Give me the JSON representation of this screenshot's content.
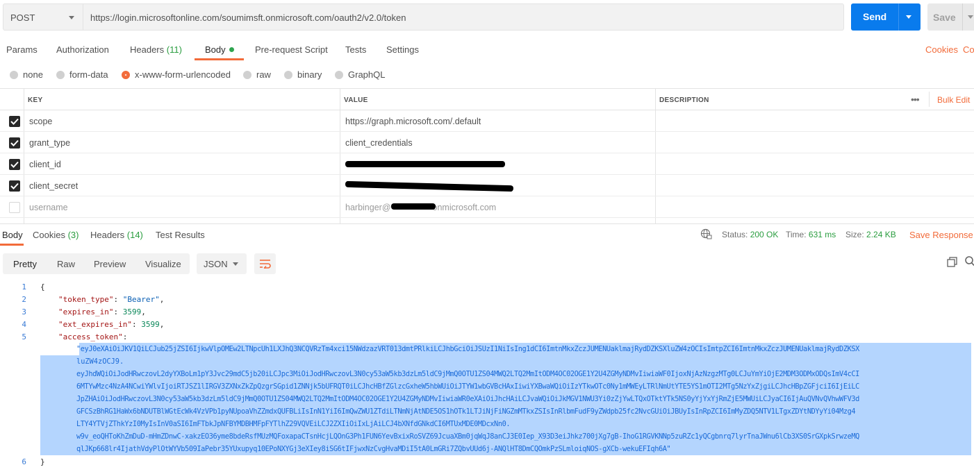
{
  "request": {
    "method": "POST",
    "url": "https://login.microsoftonline.com/soumimsft.onmicrosoft.com/oauth2/v2.0/token",
    "send_label": "Send",
    "save_label": "Save"
  },
  "req_tabs": {
    "params": "Params",
    "authorization": "Authorization",
    "headers": "Headers",
    "headers_count": "(11)",
    "body": "Body",
    "prerequest": "Pre-request Script",
    "tests": "Tests",
    "settings": "Settings",
    "cookies": "Cookies",
    "code": "Co"
  },
  "body_types": {
    "none": "none",
    "form_data": "form-data",
    "urlencoded": "x-www-form-urlencoded",
    "raw": "raw",
    "binary": "binary",
    "graphql": "GraphQL",
    "selected": "x-www-form-urlencoded"
  },
  "params_table": {
    "headers": {
      "key": "KEY",
      "value": "VALUE",
      "description": "DESCRIPTION",
      "bulk_edit": "Bulk Edit",
      "more": "•••"
    },
    "rows": [
      {
        "key": "scope",
        "value": "https://graph.microsoft.com/.default",
        "checked": true
      },
      {
        "key": "grant_type",
        "value": "client_credentials",
        "checked": true
      },
      {
        "key": "client_id",
        "value": "",
        "checked": true
      },
      {
        "key": "client_secret",
        "value": "",
        "checked": true
      },
      {
        "key": "username",
        "value_prefix": "harbinger@",
        "value_suffix": "onmicrosoft.com",
        "checked": false
      }
    ]
  },
  "response": {
    "tabs": {
      "body": "Body",
      "cookies": "Cookies",
      "cookies_count": "(3)",
      "headers": "Headers",
      "headers_count": "(14)",
      "test_results": "Test Results"
    },
    "status_label": "Status:",
    "status_value": "200 OK",
    "time_label": "Time:",
    "time_value": "631 ms",
    "size_label": "Size:",
    "size_value": "2.24 KB",
    "save_response": "Save Response",
    "views": {
      "pretty": "Pretty",
      "raw": "Raw",
      "preview": "Preview",
      "visualize": "Visualize"
    },
    "format": "JSON",
    "line_numbers": [
      "1",
      "2",
      "3",
      "4",
      "5",
      "6"
    ],
    "json": {
      "open_brace": "{",
      "close_brace": "}",
      "token_type_key": "\"token_type\"",
      "token_type_value": "\"Bearer\"",
      "expires_in_key": "\"expires_in\"",
      "expires_in_value": "3599",
      "ext_expires_in_key": "\"ext_expires_in\"",
      "ext_expires_in_value": "3599",
      "access_token_key": "\"access_token\"",
      "access_token_lines": [
        "\"eyJ0eXAiOiJKV1QiLCJub25jZSI6IjkwVlpOMEw2LTNpcUh1LXJhQ3NCQVRzTm4xci15NWdzazVRT013dmtPRlkiLCJhbGciOiJSUzI1NiIsIng1dCI6ImtnMkxZczJUMENUaklmajRydDZKSXluZW4zOCIsImtpZCI6ImtnMkxZczJUMENUaklmajRydDZKSX",
        "luZW4zOCJ9.",
        "eyJhdWQiOiJodHRwczovL2dyYXBoLm1pY3Jvc29mdC5jb20iLCJpc3MiOiJodHRwczovL3N0cy53aW5kb3dzLm5ldC9jMmQ0OTU1ZS04MWQ2LTQ2MmItODM4OC02OGE1Y2U4ZGMyNDMvIiwiaWF0IjoxNjAzNzgzMTg0LCJuYmYiOjE2MDM3ODMxODQsImV4cCI",
        "6MTYwMzc4NzA4NCwiYWlvIjoiRTJSZ1lIRGV3ZXNxZkZpQzgrSGpid1ZNNjk5bUFRQT0iLCJhcHBfZGlzcGxheW5hbWUiOiJTYW1wbGVBcHAxIiwiYXBwaWQiOiIzYTkwOTc0Ny1mMWEyLTRlNmUtYTE5YS1mOTI2MTg5NzYxZjgiLCJhcHBpZGFjciI6IjEiLC",
        "JpZHAiOiJodHRwczovL3N0cy53aW5kb3dzLm5ldC9jMmQ0OTU1ZS04MWQ2LTQ2MmItODM4OC02OGE1Y2U4ZGMyNDMvIiwiaWR0eXAiOiJhcHAiLCJvaWQiOiJkMGV1NWU3Yi0zZjYwLTQxOTktYTk5NS0yYjYxYjRmZjE5MWUiLCJyaCI6IjAuQVNvQVhwWFV3d",
        "GFCSzBhRG1HaWx6bNDUTBlWGtEcWk4VzVPb1pyNUpoaVhZZmdxQUFBLiIsInN1YiI6ImQwZWU1ZTdiLTNmNjAtNDE5OS1hOTk1LTJiNjFiNGZmMTkxZSIsInRlbmFudF9yZWdpb25fc2NvcGUiOiJBUyIsInRpZCI6ImMyZDQ5NTV1LTgxZDYtNDYyYi04Mzg4",
        "LTY4YTVjZThkYzI0MyIsInV0aSI6ImFTbkJpNFBYMDBHMFpFYTlhZ29VQVEiLCJ2ZXIiOiIxLjAiLCJ4bXNfdGNkdCI6MTUxMDE0MDcxNn0.",
        "w9v_eoQHToKhZmDuD-mHmZDnwC-xakzEO36yme8bdeRsfMUzMQFoxapaCTsnHcjLQOnG3Ph1FUN6YevBxixRoSVZ69JcuaXBm0jqWqJ8anCJ3E0Iep_X93D3eiJhkz700jXg7gB-IhoG1RGVKNNp5zuRZc1yQCgbnrq7lyrTnaJWnu6lCb3XS0SrGXpkSrwzeMQ",
        "qlJKp668lr4IjathVdyPlOtWYVb509IaPebr35YUxupyq10EPoNXYGj3eXIey8iSG6tIFjwxNzCvgHvaMDiI5tA0LmGRi7ZQbvUUd6j-ANQlHT8DmCQOmkPzSLmloiqNOS-gXCb-wekuEFIqh6A\""
      ]
    }
  }
}
